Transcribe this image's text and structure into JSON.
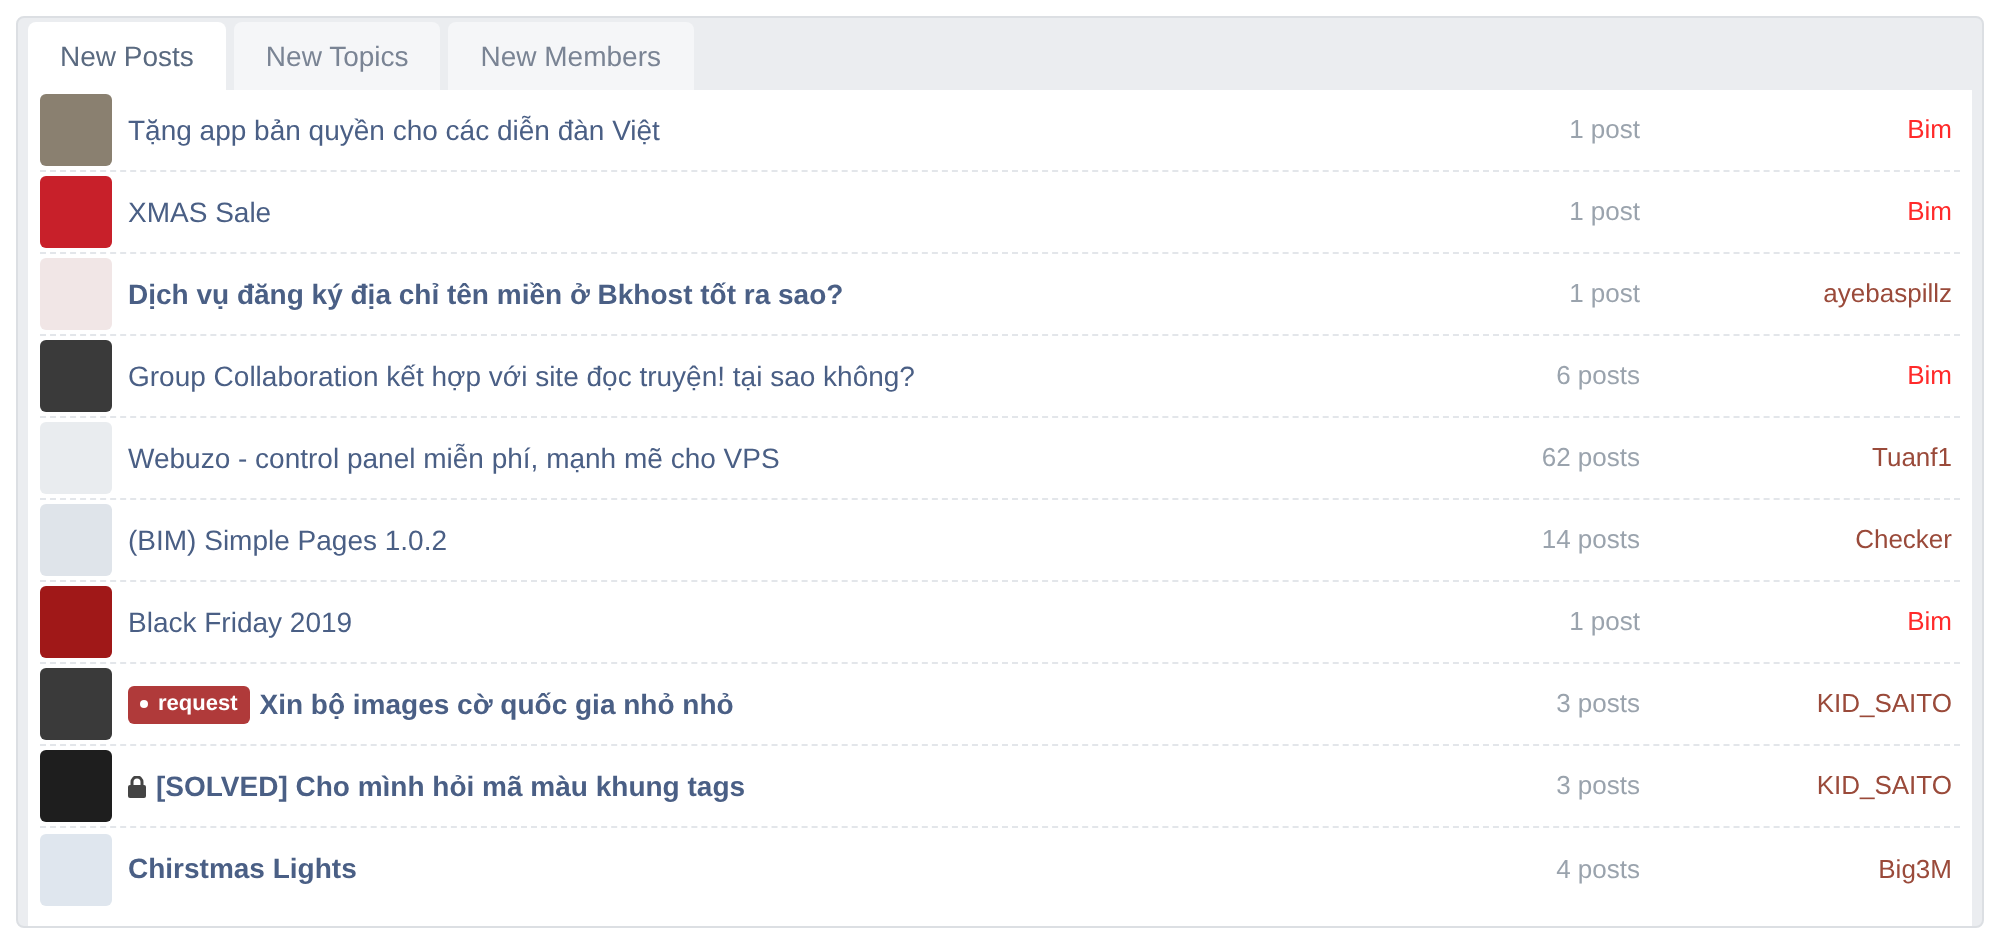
{
  "tabs": [
    {
      "label": "New Posts",
      "selected": true
    },
    {
      "label": "New Topics",
      "selected": false
    },
    {
      "label": "New Members",
      "selected": false
    }
  ],
  "threads": [
    {
      "title": "Tặng app bản quyền cho các diễn đàn Việt",
      "unread": false,
      "locked": false,
      "replies": "1 post",
      "author": "Bim",
      "color": "#ff2a2a"
    },
    {
      "title": "XMAS Sale",
      "unread": false,
      "locked": false,
      "replies": "1 post",
      "author": "Bim",
      "color": "#ff2a2a"
    },
    {
      "title": "Dịch vụ đăng ký địa chỉ tên miền ở Bkhost tốt ra sao?",
      "unread": true,
      "locked": false,
      "replies": "1 post",
      "author": "ayebaspillz",
      "color": "#9a4a3a"
    },
    {
      "title": "Group Collaboration kết hợp với site đọc truyện! tại sao không?",
      "unread": false,
      "locked": false,
      "replies": "6 posts",
      "author": "Bim",
      "color": "#ff2a2a"
    },
    {
      "title": "Webuzo - control panel miễn phí, mạnh mẽ cho VPS",
      "unread": false,
      "locked": false,
      "replies": "62 posts",
      "author": "Tuanf1",
      "color": "#9a4a3a"
    },
    {
      "title": "(BIM) Simple Pages 1.0.2",
      "unread": false,
      "locked": false,
      "replies": "14 posts",
      "author": "Checker",
      "color": "#9a4a3a"
    },
    {
      "title": "Black Friday 2019",
      "unread": false,
      "locked": false,
      "replies": "1 post",
      "author": "Bim",
      "color": "#ff2a2a"
    },
    {
      "title": "Xin bộ images cờ quốc gia nhỏ nhỏ",
      "prefix": "request",
      "unread": true,
      "locked": false,
      "replies": "3 posts",
      "author": "KID_SAITO",
      "color": "#9a4a3a"
    },
    {
      "title": "[SOLVED] Cho mình hỏi mã màu khung tags",
      "unread": true,
      "locked": true,
      "replies": "3 posts",
      "author": "KID_SAITO",
      "color": "#9a4a3a"
    },
    {
      "title": "Chirstmas Lights",
      "unread": true,
      "locked": false,
      "replies": "4 posts",
      "author": "Big3M",
      "color": "#9a4a3a"
    }
  ]
}
